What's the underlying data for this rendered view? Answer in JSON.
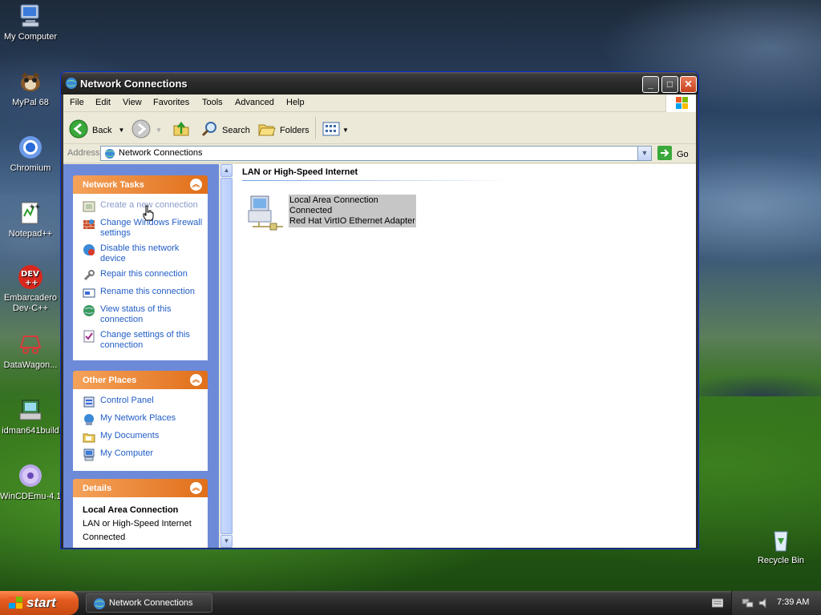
{
  "desktop": {
    "icons": [
      {
        "label": "My Computer"
      },
      {
        "label": "MyPal 68"
      },
      {
        "label": "Chromium"
      },
      {
        "label": "Notepad++"
      },
      {
        "label": "Embarcadero"
      },
      {
        "label": "Dev-C++"
      },
      {
        "label": "DataWagon..."
      },
      {
        "label": "idman641build"
      },
      {
        "label": "WinCDEmu-4.1"
      },
      {
        "label": "Recycle Bin"
      }
    ]
  },
  "window": {
    "title": "Network Connections",
    "menu": [
      "File",
      "Edit",
      "View",
      "Favorites",
      "Tools",
      "Advanced",
      "Help"
    ],
    "toolbar": {
      "back": "Back",
      "search": "Search",
      "folders": "Folders"
    },
    "address": {
      "label": "Address",
      "value": "Network Connections",
      "go": "Go"
    }
  },
  "left_pane": {
    "network_tasks": {
      "title": "Network Tasks",
      "items": [
        "Create a new connection",
        "Change Windows Firewall settings",
        "Disable this network device",
        "Repair this connection",
        "Rename this connection",
        "View status of this connection",
        "Change settings of this connection"
      ]
    },
    "other_places": {
      "title": "Other Places",
      "items": [
        "Control Panel",
        "My Network Places",
        "My Documents",
        "My Computer"
      ]
    },
    "details": {
      "title": "Details",
      "name": "Local Area Connection",
      "type": "LAN or High-Speed Internet",
      "status": "Connected"
    }
  },
  "main": {
    "group": "LAN or High-Speed Internet",
    "connection": {
      "name": "Local Area Connection",
      "status": "Connected",
      "adapter": "Red Hat VirtIO Ethernet Adapter"
    }
  },
  "taskbar": {
    "start": "start",
    "task": "Network Connections",
    "clock": "7:39 AM"
  }
}
